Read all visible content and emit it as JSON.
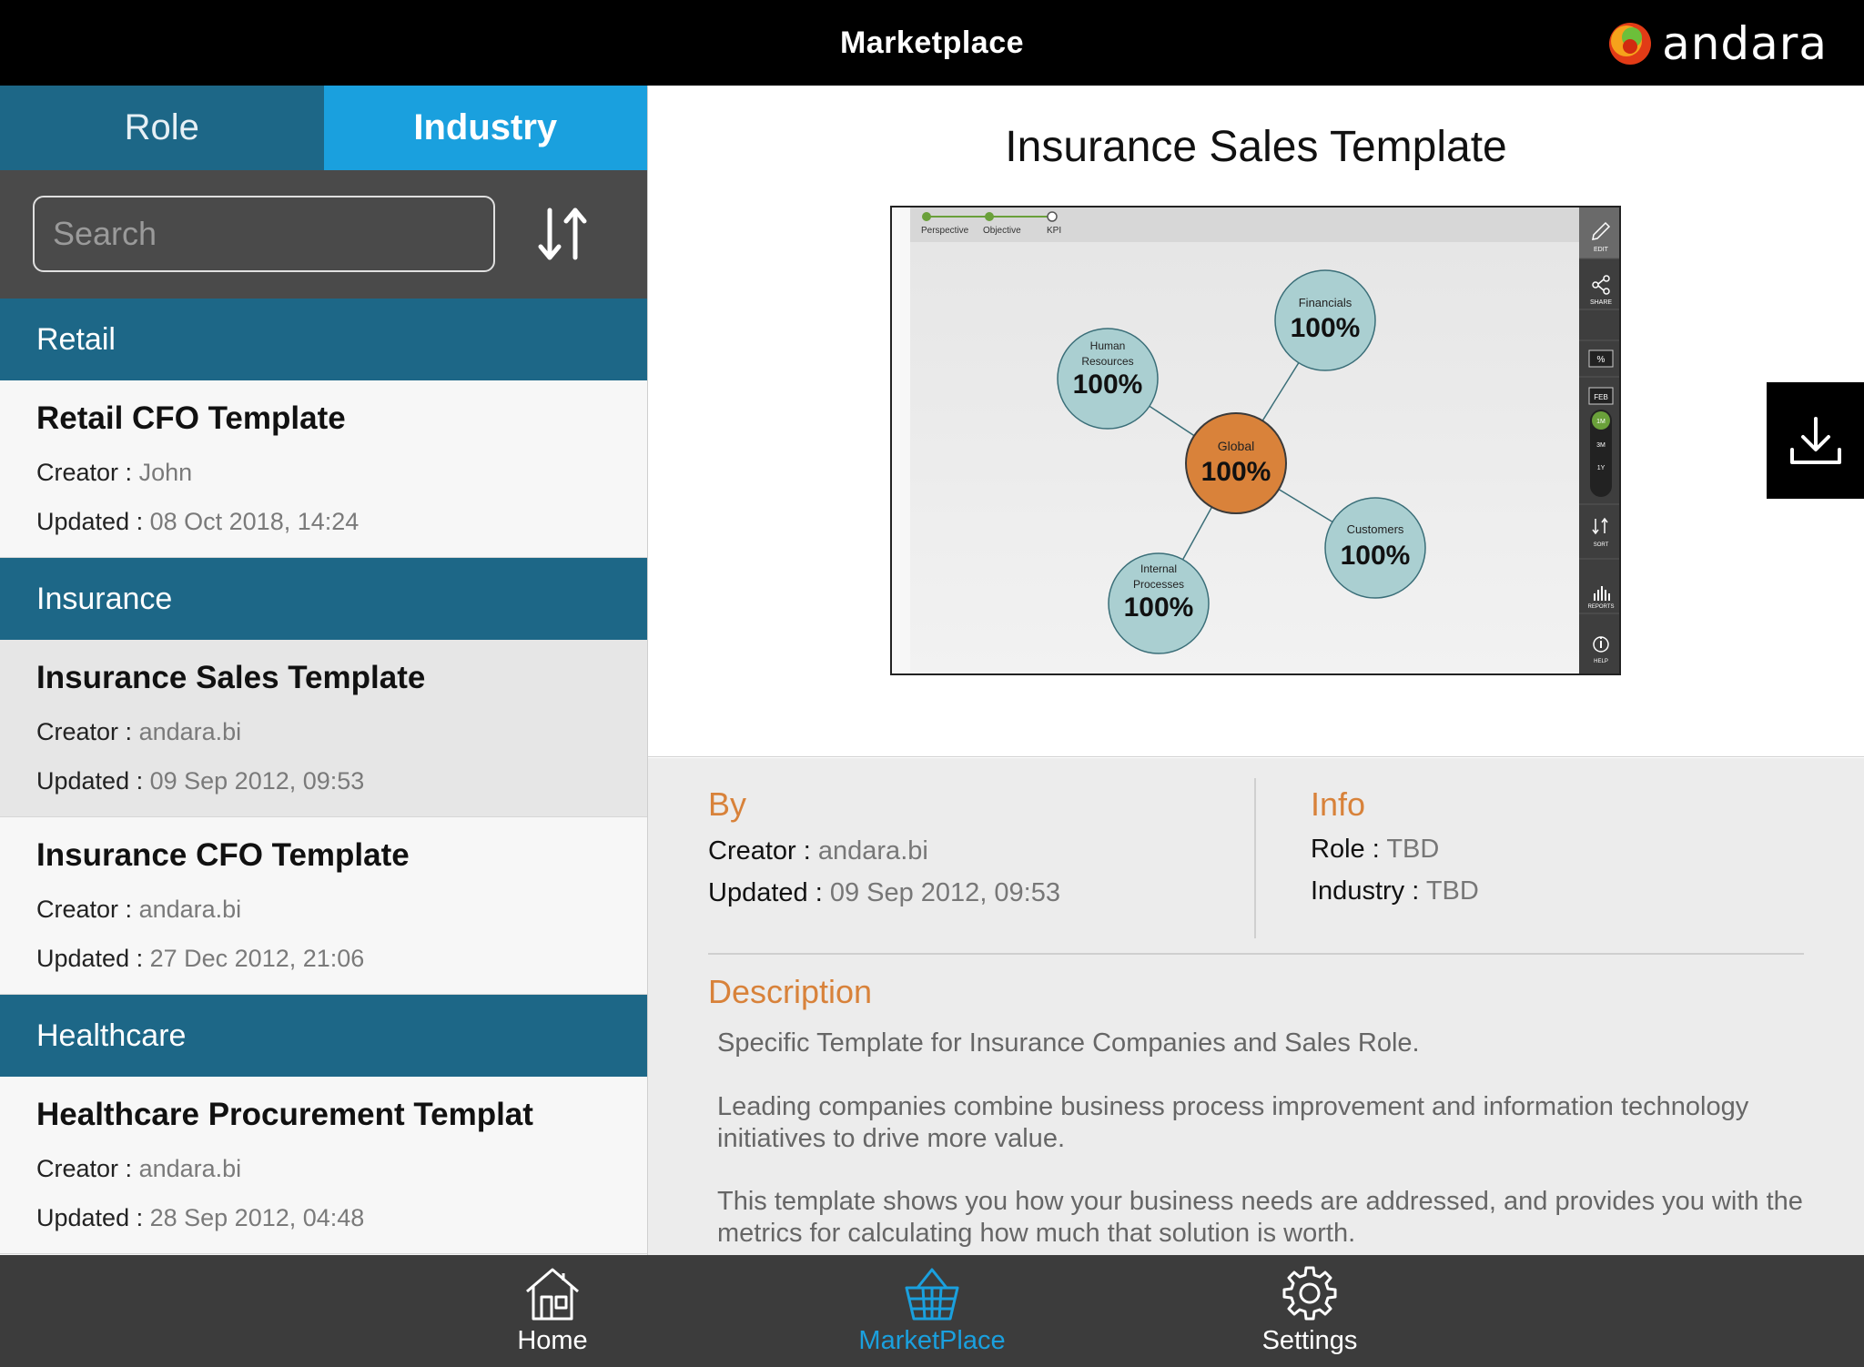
{
  "header": {
    "title": "Marketplace",
    "brand": "andara"
  },
  "tabs": [
    {
      "label": "Role",
      "active": false
    },
    {
      "label": "Industry",
      "active": true
    }
  ],
  "search": {
    "placeholder": "Search",
    "value": ""
  },
  "sections": [
    {
      "title": "Retail",
      "items": [
        {
          "name": "Retail CFO Template",
          "creator_label": "Creator :",
          "creator": "John",
          "updated_label": "Updated :",
          "updated": "08 Oct 2018, 14:24"
        }
      ]
    },
    {
      "title": "Insurance",
      "items": [
        {
          "name": "Insurance Sales Template",
          "creator_label": "Creator :",
          "creator": "andara.bi",
          "updated_label": "Updated :",
          "updated": "09 Sep 2012, 09:53",
          "selected": true
        },
        {
          "name": "Insurance CFO Template",
          "creator_label": "Creator :",
          "creator": "andara.bi",
          "updated_label": "Updated :",
          "updated": "27 Dec 2012, 21:06"
        }
      ]
    },
    {
      "title": "Healthcare",
      "items": [
        {
          "name": "Healthcare Procurement Templat",
          "creator_label": "Creator :",
          "creator": "andara.bi",
          "updated_label": "Updated :",
          "updated": "28 Sep 2012, 04:48"
        }
      ]
    }
  ],
  "detail": {
    "title": "Insurance Sales Template",
    "preview": {
      "steps": [
        "Perspective",
        "Objective",
        "KPI"
      ],
      "nodes": {
        "global": {
          "label": "Global",
          "value": "100%"
        },
        "financials": {
          "label": "Financials",
          "value": "100%"
        },
        "hr_line1": "Human",
        "hr_line2": "Resources",
        "hr_value": "100%",
        "customers": {
          "label": "Customers",
          "value": "100%"
        },
        "ip_line1": "Internal",
        "ip_line2": "Processes",
        "ip_value": "100%"
      },
      "sidebar": {
        "edit": "EDIT",
        "share": "SHARE",
        "percent": "%",
        "month": "FEB",
        "r1": "1M",
        "r2": "3M",
        "r3": "1Y",
        "sort": "SORT",
        "reports": "REPORTS",
        "help": "HELP"
      }
    },
    "by": {
      "heading": "By",
      "creator_label": "Creator :",
      "creator": "andara.bi",
      "updated_label": "Updated :",
      "updated": "09 Sep 2012, 09:53"
    },
    "info": {
      "heading": "Info",
      "role_label": "Role :",
      "role": "TBD",
      "industry_label": "Industry :",
      "industry": "TBD"
    },
    "description": {
      "heading": "Description",
      "p1": "Specific Template for Insurance Companies and Sales Role.",
      "p2": "Leading companies combine business process improvement and information technology initiatives to drive more value.",
      "p3": "This template shows you how your business needs are addressed, and provides you with the metrics for calculating how much that solution is worth."
    }
  },
  "bottom_nav": [
    {
      "label": "Home",
      "active": false
    },
    {
      "label": "MarketPlace",
      "active": true
    },
    {
      "label": "Settings",
      "active": false
    }
  ],
  "colors": {
    "section_bg": "#1d6787",
    "tab_active": "#1aa0de",
    "accent_orange": "#d8823a",
    "node_fill": "#aacfd1",
    "global_fill": "#d9823a"
  }
}
